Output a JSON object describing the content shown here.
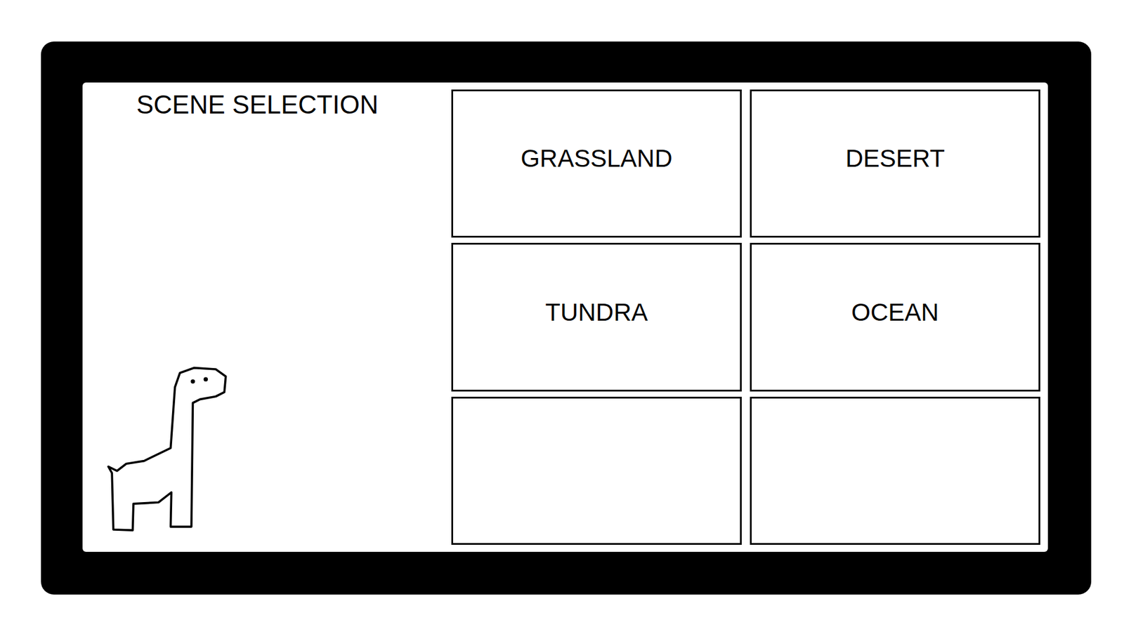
{
  "screen": {
    "title": "SCENE SELECTION"
  },
  "scenes": [
    {
      "label": "GRASSLAND"
    },
    {
      "label": "DESERT"
    },
    {
      "label": "TUNDRA"
    },
    {
      "label": "OCEAN"
    },
    {
      "label": ""
    },
    {
      "label": ""
    }
  ]
}
